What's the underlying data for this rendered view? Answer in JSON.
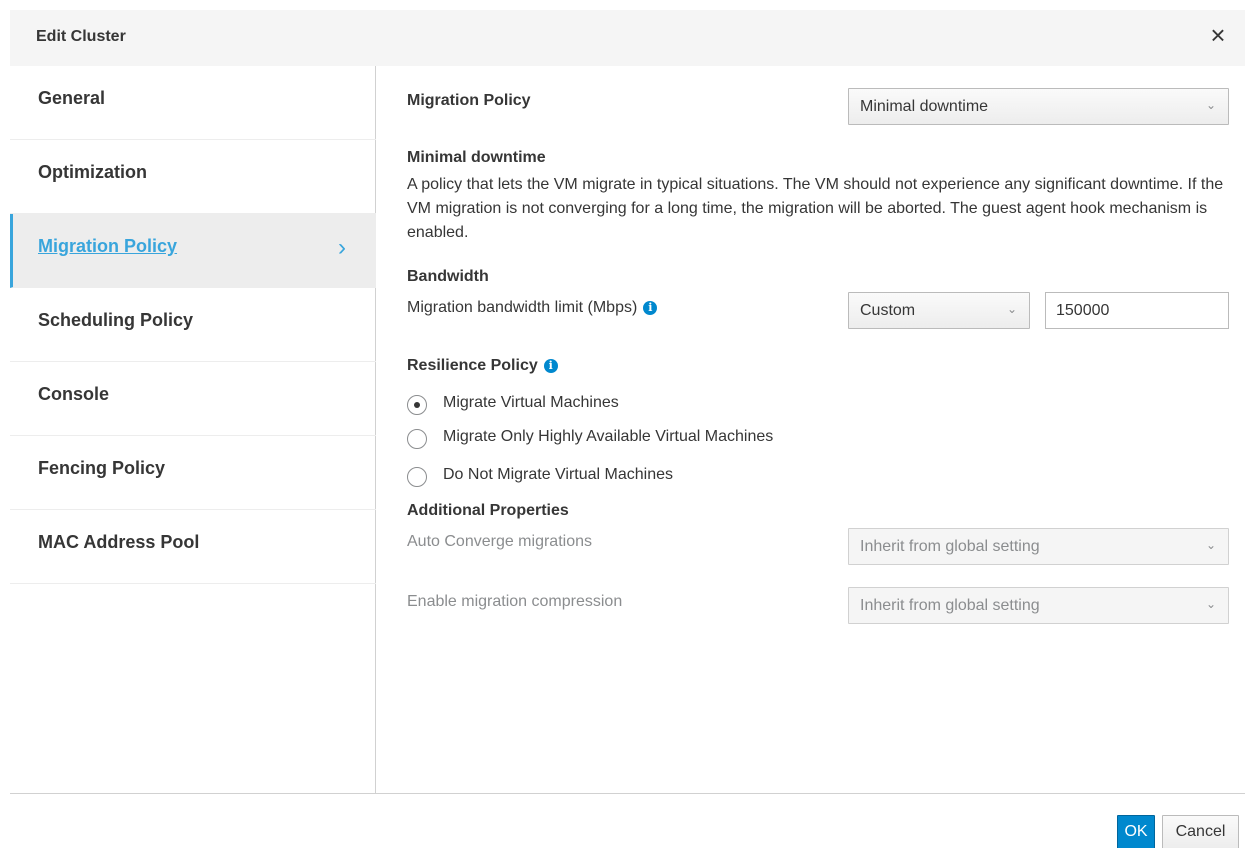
{
  "dialog": {
    "title": "Edit Cluster",
    "close_icon": "×"
  },
  "sidebar": {
    "items": [
      {
        "label": "General",
        "active": false
      },
      {
        "label": "Optimization",
        "active": false
      },
      {
        "label": "Migration Policy",
        "active": true
      },
      {
        "label": "Scheduling Policy",
        "active": false
      },
      {
        "label": "Console",
        "active": false
      },
      {
        "label": "Fencing Policy",
        "active": false
      },
      {
        "label": "MAC Address Pool",
        "active": false
      }
    ],
    "active_chevron": "›"
  },
  "migration": {
    "policy_label": "Migration Policy",
    "policy_value": "Minimal downtime",
    "desc_title": "Minimal downtime",
    "desc_text": "A policy that lets the VM migrate in typical situations. The VM should not experience any significant downtime. If the VM migration is not converging for a long time, the migration will be aborted. The guest agent hook mechanism is enabled."
  },
  "bandwidth": {
    "title": "Bandwidth",
    "limit_label": "Migration bandwidth limit (Mbps)",
    "mode_value": "Custom",
    "limit_value": "150000"
  },
  "resilience": {
    "title": "Resilience Policy",
    "options": [
      {
        "label": "Migrate Virtual Machines",
        "checked": true
      },
      {
        "label": "Migrate Only Highly Available Virtual Machines",
        "checked": false
      },
      {
        "label": "Do Not Migrate Virtual Machines",
        "checked": false
      }
    ]
  },
  "additional": {
    "title": "Additional Properties",
    "auto_converge_label": "Auto Converge migrations",
    "auto_converge_value": "Inherit from global setting",
    "compression_label": "Enable migration compression",
    "compression_value": "Inherit from global setting"
  },
  "footer": {
    "ok_label": "OK",
    "cancel_label": "Cancel"
  },
  "colors": {
    "accent": "#39a5dc",
    "primary_button": "#0088ce"
  }
}
